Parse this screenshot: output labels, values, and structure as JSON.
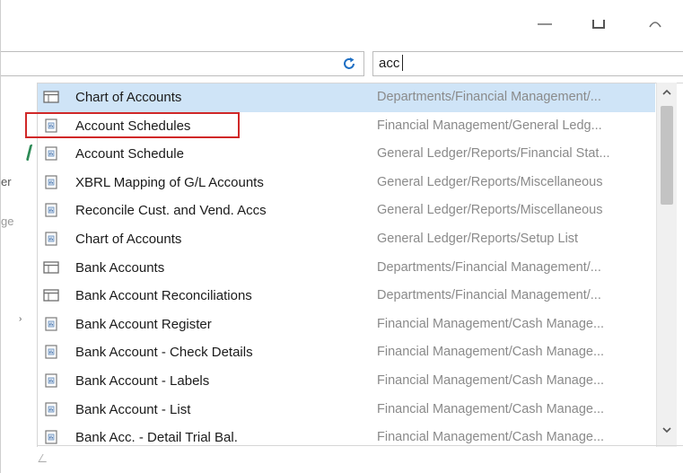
{
  "window": {
    "minimize_icon": "minimize-icon",
    "maximize_icon": "maximize-icon",
    "close_icon": "close-icon"
  },
  "search": {
    "value": "acc",
    "refresh_icon": "refresh-icon"
  },
  "side_fragments": [
    "er",
    "ge"
  ],
  "accent_colors": {
    "selection": "#cfe4f7",
    "highlight": "#d02828",
    "page_icon": "#7a9cc6"
  },
  "results": [
    {
      "icon": "list-page-icon",
      "name": "Chart of Accounts",
      "path": "Departments/Financial Management/...",
      "selected": true
    },
    {
      "icon": "report-icon",
      "name": "Account Schedules",
      "path": "Financial Management/General Ledg...",
      "highlighted": true
    },
    {
      "icon": "report-icon",
      "name": "Account Schedule",
      "path": "General Ledger/Reports/Financial Stat..."
    },
    {
      "icon": "report-icon",
      "name": "XBRL Mapping of G/L Accounts",
      "path": "General Ledger/Reports/Miscellaneous"
    },
    {
      "icon": "report-icon",
      "name": "Reconcile Cust. and Vend. Accs",
      "path": "General Ledger/Reports/Miscellaneous"
    },
    {
      "icon": "report-icon",
      "name": "Chart of Accounts",
      "path": "General Ledger/Reports/Setup List"
    },
    {
      "icon": "list-page-icon",
      "name": "Bank Accounts",
      "path": "Departments/Financial Management/..."
    },
    {
      "icon": "list-page-icon",
      "name": "Bank Account Reconciliations",
      "path": "Departments/Financial Management/..."
    },
    {
      "icon": "report-icon",
      "name": "Bank Account Register",
      "path": "Financial Management/Cash Manage..."
    },
    {
      "icon": "report-icon",
      "name": "Bank Account - Check Details",
      "path": "Financial Management/Cash Manage..."
    },
    {
      "icon": "report-icon",
      "name": "Bank Account - Labels",
      "path": "Financial Management/Cash Manage..."
    },
    {
      "icon": "report-icon",
      "name": "Bank Account - List",
      "path": "Financial Management/Cash Manage..."
    },
    {
      "icon": "report-icon",
      "name": "Bank Acc. - Detail Trial Bal.",
      "path": "Financial Management/Cash Manage..."
    }
  ]
}
